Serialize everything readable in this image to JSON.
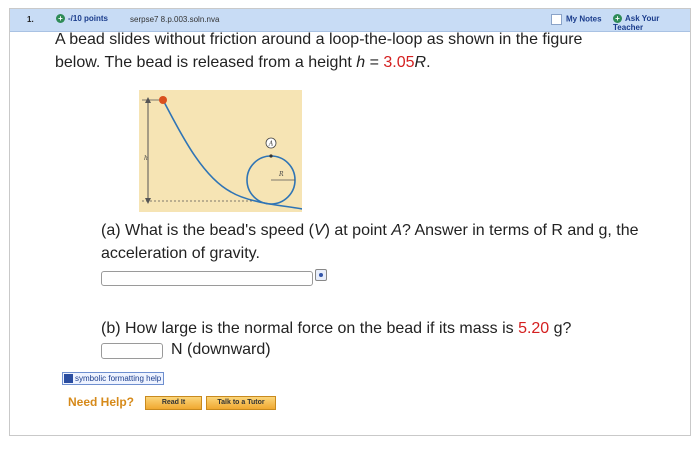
{
  "header": {
    "question_number": "1.",
    "points": "-/10 points",
    "source": "serpse7 8.p.003.soln.nva",
    "my_notes": "My Notes",
    "ask_teacher": "Ask Your Teacher"
  },
  "question": {
    "line1": "A bead slides without friction around a loop-the-loop as shown in the figure",
    "line2_pre": "below. The bead is released from a height ",
    "h_symbol": "h",
    "equals": " = ",
    "h_value": "3.05",
    "r_symbol": "R",
    "period": "."
  },
  "figure": {
    "label_A": "A",
    "label_h": "h",
    "label_R": "R"
  },
  "part_a": {
    "text_pre": "(a) What is the bead's speed (",
    "v_symbol": "V",
    "text_mid": ") at point ",
    "a_symbol": "A",
    "text_post": "? Answer in terms of R and g, the acceleration of gravity.",
    "answer_value": ""
  },
  "part_b": {
    "text_pre": "(b) How large is the normal force on the bead if its mass is ",
    "mass_value": "5.20",
    "text_post": " g?",
    "answer_value": "",
    "unit": "N (downward)"
  },
  "symbolic_help": "symbolic formatting help",
  "need_help": "Need Help?",
  "read_it": "Read It",
  "talk_tutor": "Talk to a Tutor",
  "colors": {
    "header_bg": "#c8dcf5",
    "accent_red": "#d42020",
    "need_help": "#d68a1a",
    "button": "#f0a830"
  }
}
